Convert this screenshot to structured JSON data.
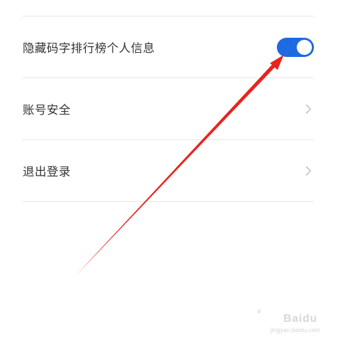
{
  "settings": {
    "items": [
      {
        "label": "隐藏码字排行榜个人信息",
        "control": "toggle",
        "toggle_on": true
      },
      {
        "label": "账号安全",
        "control": "chevron"
      },
      {
        "label": "退出登录",
        "control": "chevron"
      }
    ]
  },
  "colors": {
    "toggle_on": "#1e6ae0",
    "annotation_arrow": "#e8231e",
    "divider": "#e6e6e6",
    "label": "#333333"
  },
  "icons": {
    "chevron": "chevron-right-icon",
    "arrow": "annotation-arrow-icon",
    "watermark": "baidu-jingyan-watermark-icon"
  },
  "watermark": {
    "brand": "Baidu",
    "sub": "jingyan.baidu.com"
  }
}
